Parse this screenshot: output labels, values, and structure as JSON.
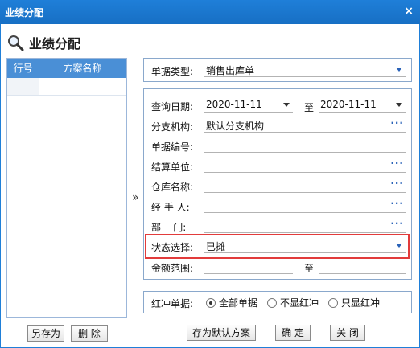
{
  "window": {
    "title": "业绩分配",
    "close_glyph": "×"
  },
  "heading": {
    "icon": "magnifier-icon",
    "text": "业绩分配"
  },
  "scheme_table": {
    "columns": [
      "行号",
      "方案名称"
    ],
    "rows": []
  },
  "expand_arrow": "»",
  "doc_type": {
    "label": "单据类型:",
    "value": "销售出库单"
  },
  "query_date": {
    "label": "查询日期:",
    "from": "2020-11-11",
    "to_label": "至",
    "to": "2020-11-11"
  },
  "branch": {
    "label": "分支机构:",
    "value": "默认分支机构"
  },
  "doc_no": {
    "label": "单据编号:",
    "value": ""
  },
  "settle_unit": {
    "label": "结算单位:",
    "value": ""
  },
  "warehouse": {
    "label": "仓库名称:",
    "value": ""
  },
  "handler": {
    "label": "经 手 人:",
    "value": ""
  },
  "department": {
    "label": "部    门:",
    "value": ""
  },
  "status": {
    "label": "状态选择:",
    "value": "已摊"
  },
  "amount": {
    "label": "金额范围:",
    "to_label": "至"
  },
  "reverse": {
    "label": "红冲单据:",
    "options": [
      "全部单据",
      "不显红冲",
      "只显红冲"
    ],
    "selected": "全部单据"
  },
  "buttons": {
    "save_as": "另存为",
    "delete": "删 除",
    "save_default": "存为默认方案",
    "ok": "确 定",
    "close": "关 闭"
  },
  "icons": {
    "ellipsis": "···"
  },
  "colors": {
    "titlebar": "#1f7fd8",
    "highlight": "#e23b3b",
    "accent": "#2a62b8"
  }
}
